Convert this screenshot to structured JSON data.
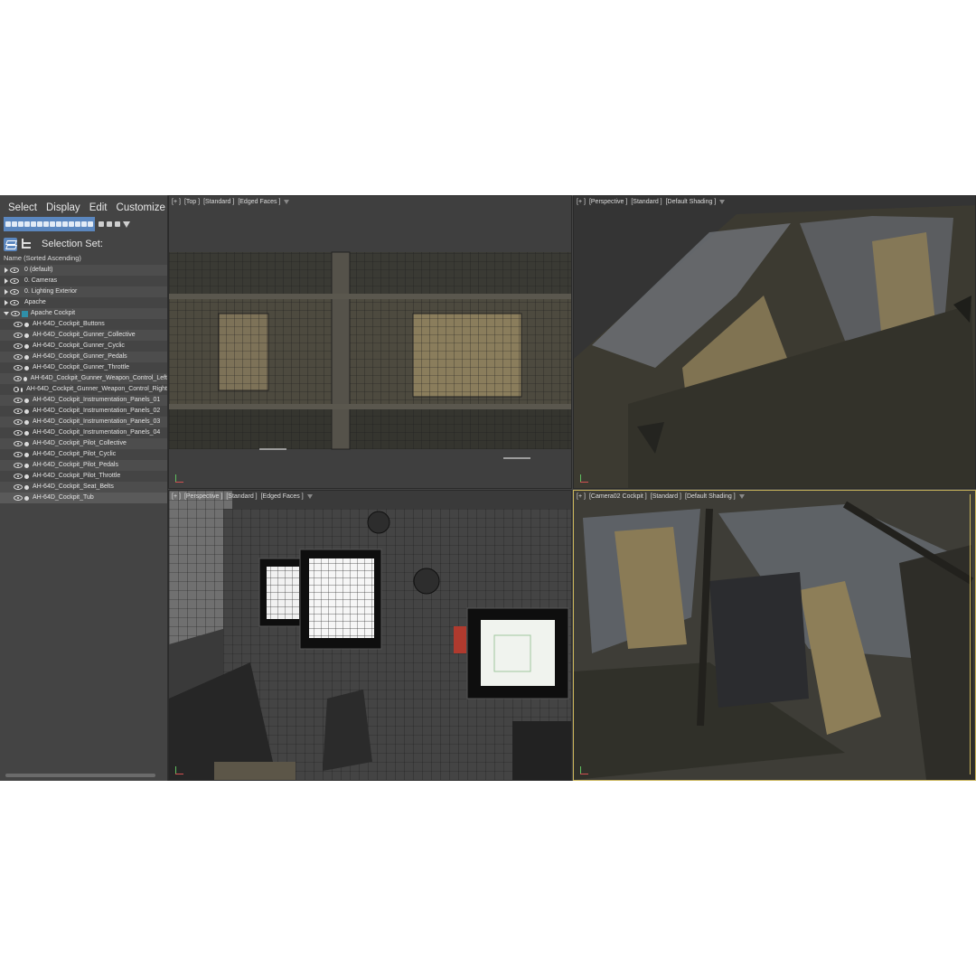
{
  "menu": [
    "Select",
    "Display",
    "Edit",
    "Customize"
  ],
  "selection_set_label": "Selection Set:",
  "column_header": "Name (Sorted Ascending)",
  "tree": [
    {
      "label": "0 (default)",
      "type": "layer",
      "expanded": false
    },
    {
      "label": "0. Cameras",
      "type": "layer",
      "expanded": false
    },
    {
      "label": "0. Lighting Exterior",
      "type": "layer",
      "expanded": false
    },
    {
      "label": "Apache",
      "type": "layer",
      "expanded": false
    },
    {
      "label": "Apache Cockpit",
      "type": "layer",
      "expanded": true
    },
    {
      "label": "AH-64D_Cockpit_Buttons",
      "type": "object"
    },
    {
      "label": "AH-64D_Cockpit_Gunner_Collective",
      "type": "object"
    },
    {
      "label": "AH-64D_Cockpit_Gunner_Cyclic",
      "type": "object"
    },
    {
      "label": "AH-64D_Cockpit_Gunner_Pedals",
      "type": "object"
    },
    {
      "label": "AH-64D_Cockpit_Gunner_Throttle",
      "type": "object"
    },
    {
      "label": "AH-64D_Cockpit_Gunner_Weapon_Control_Left",
      "type": "object"
    },
    {
      "label": "AH-64D_Cockpit_Gunner_Weapon_Control_Right",
      "type": "object"
    },
    {
      "label": "AH-64D_Cockpit_Instrumentation_Panels_01",
      "type": "object"
    },
    {
      "label": "AH-64D_Cockpit_Instrumentation_Panels_02",
      "type": "object"
    },
    {
      "label": "AH-64D_Cockpit_Instrumentation_Panels_03",
      "type": "object"
    },
    {
      "label": "AH-64D_Cockpit_Instrumentation_Panels_04",
      "type": "object"
    },
    {
      "label": "AH-64D_Cockpit_Pilot_Collective",
      "type": "object"
    },
    {
      "label": "AH-64D_Cockpit_Pilot_Cyclic",
      "type": "object"
    },
    {
      "label": "AH-64D_Cockpit_Pilot_Pedals",
      "type": "object"
    },
    {
      "label": "AH-64D_Cockpit_Pilot_Throttle",
      "type": "object"
    },
    {
      "label": "AH-64D_Cockpit_Seat_Belts",
      "type": "object"
    },
    {
      "label": "AH-64D_Cockpit_Tub",
      "type": "object"
    }
  ],
  "viewports": {
    "top": {
      "plus": "[+ ]",
      "view": "[Top ]",
      "shading": "[Standard ]",
      "mode": "[Edged Faces ]"
    },
    "perspective": {
      "plus": "[+ ]",
      "view": "[Perspective ]",
      "shading": "[Standard ]",
      "mode": "[Default Shading ]"
    },
    "perspective2": {
      "plus": "[+ ]",
      "view": "[Perspective ]",
      "shading": "[Standard ]",
      "mode": "[Edged Faces ]"
    },
    "camera": {
      "plus": "[+ ]",
      "view": "[Camera02 Cockpit ]",
      "shading": "[Standard ]",
      "mode": "[Default Shading ]"
    }
  },
  "colors": {
    "accent": "#5b87bf",
    "active_viewport_border": "#c9b45a",
    "panel_bg": "#444444"
  }
}
